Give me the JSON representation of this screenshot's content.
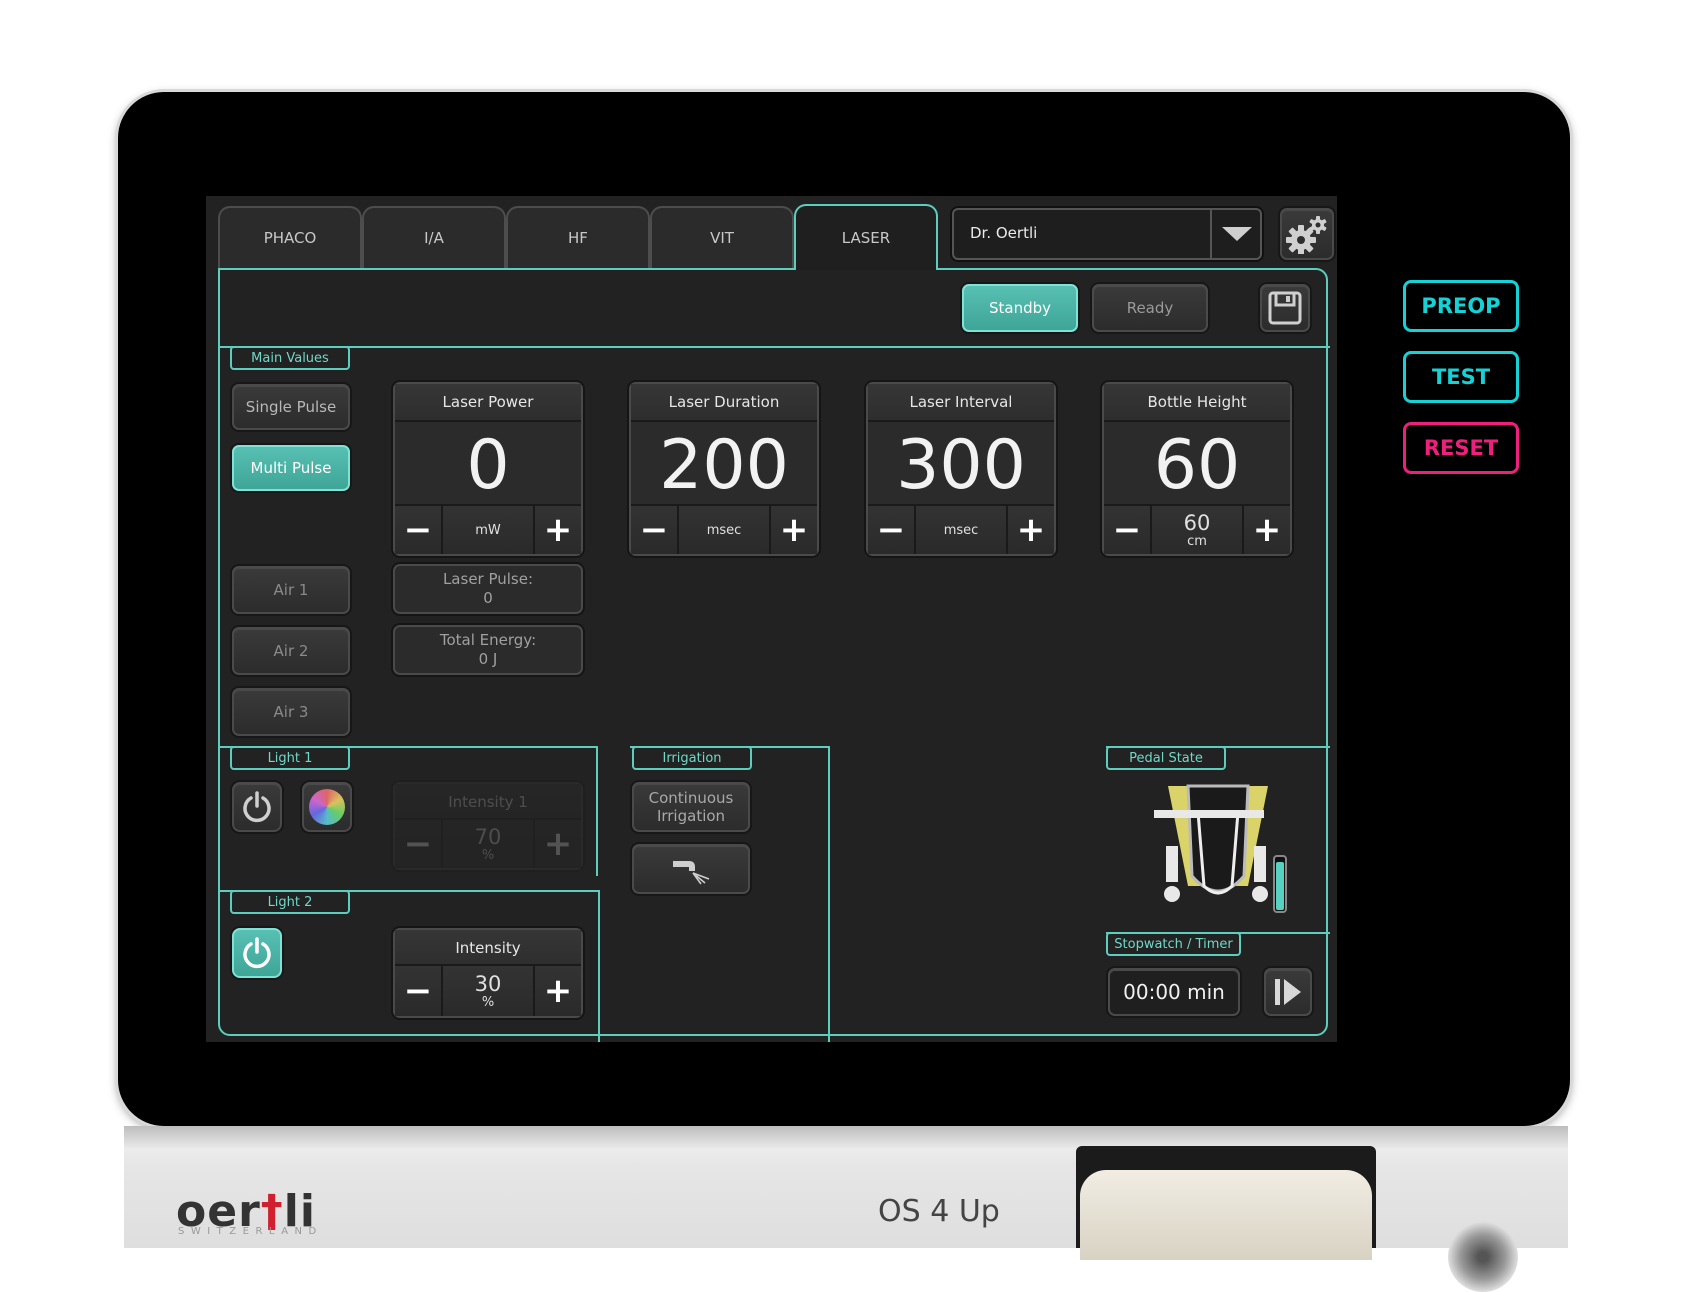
{
  "tabs": [
    {
      "label": "PHACO",
      "active": false
    },
    {
      "label": "I/A",
      "active": false
    },
    {
      "label": "HF",
      "active": false
    },
    {
      "label": "VIT",
      "active": false
    },
    {
      "label": "LASER",
      "active": true
    }
  ],
  "surgeon": {
    "selected": "Dr. Oertli"
  },
  "mode": {
    "standby": "Standby",
    "ready": "Ready"
  },
  "main_values": {
    "label": "Main Values",
    "single_pulse": "Single Pulse",
    "multi_pulse": "Multi Pulse",
    "air_buttons": [
      "Air 1",
      "Air 2",
      "Air 3"
    ],
    "cards": {
      "laser_power": {
        "title": "Laser Power",
        "value": "0",
        "unit": "mW"
      },
      "laser_duration": {
        "title": "Laser Duration",
        "value": "200",
        "unit": "msec"
      },
      "laser_interval": {
        "title": "Laser Interval",
        "value": "300",
        "unit": "msec"
      },
      "bottle_height": {
        "title": "Bottle Height",
        "value": "60",
        "unit_value": "60",
        "unit": "cm"
      }
    },
    "laser_pulse": {
      "label": "Laser Pulse:",
      "value": "0"
    },
    "total_energy": {
      "label": "Total Energy:",
      "value": "0 J"
    }
  },
  "light1": {
    "label": "Light 1",
    "intensity_title": "Intensity 1",
    "value": "70",
    "unit": "%"
  },
  "light2": {
    "label": "Light 2",
    "intensity_title": "Intensity",
    "value": "30",
    "unit": "%"
  },
  "irrigation": {
    "label": "Irrigation",
    "continuous": "Continuous Irrigation"
  },
  "pedal": {
    "label": "Pedal State"
  },
  "stopwatch": {
    "label": "Stopwatch / Timer",
    "value": "00:00 min"
  },
  "hardware_buttons": {
    "preop": "PREOP",
    "test": "TEST",
    "reset": "RESET"
  },
  "brand": {
    "logo": "oertli",
    "tagline": "SWITZERLAND",
    "model": "OS 4 Up"
  },
  "colors": {
    "accent": "#5dcdbd",
    "preop": "#14d2d6",
    "reset": "#ef1f7d"
  }
}
